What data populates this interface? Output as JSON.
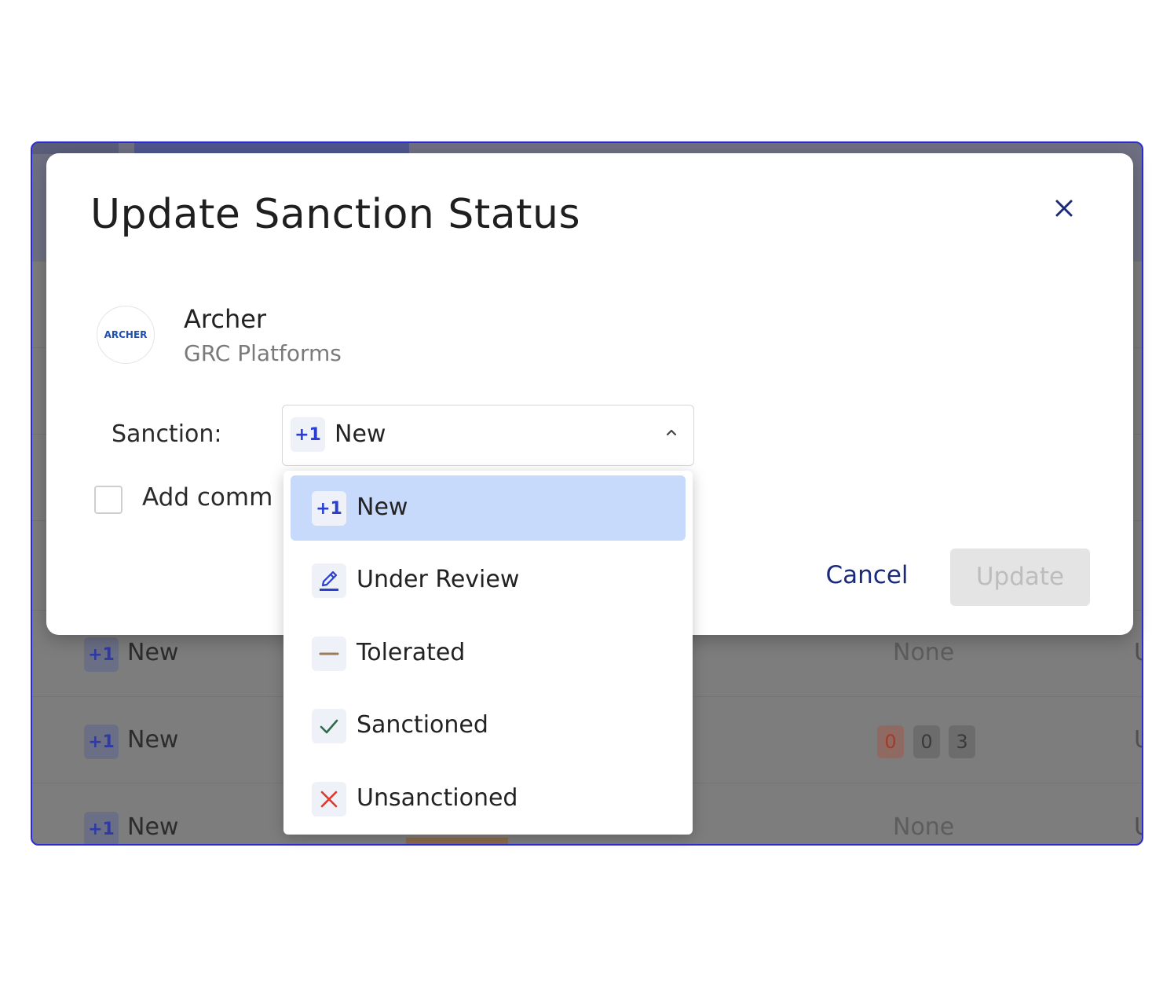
{
  "dialog": {
    "title": "Update Sanction Status",
    "close_label": "close"
  },
  "app": {
    "logo_text": "ARCHER",
    "name": "Archer",
    "category": "GRC Platforms"
  },
  "sanction": {
    "label": "Sanction:",
    "selected_badge": "+1",
    "selected_value": "New"
  },
  "comment": {
    "label": "Add comm"
  },
  "actions": {
    "cancel_label": "Cancel",
    "update_label": "Update"
  },
  "dropdown": {
    "options": [
      {
        "label": "New",
        "badge": "+1",
        "icon": "plus-one-icon",
        "selected": true
      },
      {
        "label": "Under Review",
        "icon": "pencil-icon",
        "color": "#2a3fd1"
      },
      {
        "label": "Tolerated",
        "icon": "minus-icon",
        "color": "#9a7b5a"
      },
      {
        "label": "Sanctioned",
        "icon": "check-icon",
        "color": "#2f6b4a"
      },
      {
        "label": "Unsanctioned",
        "icon": "x-icon",
        "color": "#e0382b"
      }
    ]
  },
  "background": {
    "rows": [
      {
        "badge": "+1",
        "status": "New",
        "source": "None",
        "edge": "Ur"
      },
      {
        "badge": "+1",
        "status": "New",
        "counts": [
          "0",
          "0",
          "3"
        ],
        "edge": "Ur"
      },
      {
        "badge": "+1",
        "status": "New",
        "source": "None",
        "edge": "Ur"
      }
    ]
  }
}
